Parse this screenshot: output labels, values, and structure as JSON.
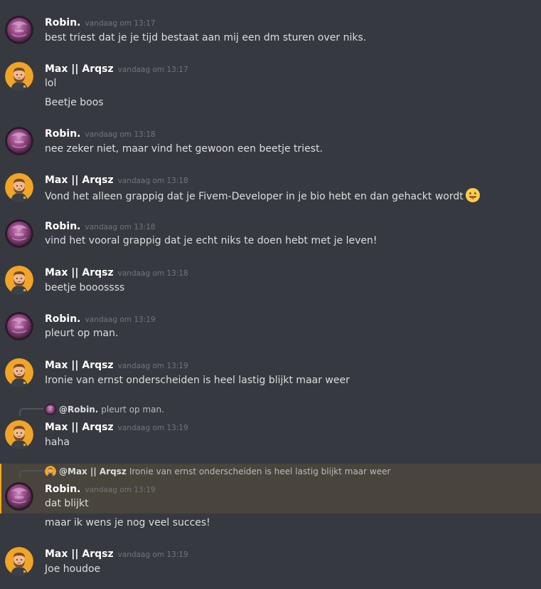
{
  "messages": [
    {
      "author": "Robin.",
      "time": "vandaag om 13:17",
      "lines": [
        "best triest dat je je tijd bestaat aan mij een dm sturen over niks."
      ]
    },
    {
      "author": "Max || Arqsz",
      "time": "vandaag om 13:17",
      "lines": [
        "lol",
        "Beetje boos"
      ]
    },
    {
      "author": "Robin.",
      "time": "vandaag om 13:18",
      "lines": [
        "nee zeker niet, maar vind het gewoon een beetje triest."
      ]
    },
    {
      "author": "Max || Arqsz",
      "time": "vandaag om 13:18",
      "lines": [
        "Vond het alleen grappig dat je Fivem-Developer in je bio hebt en dan gehackt wordt"
      ],
      "emoji": "tongue-out-emoji"
    },
    {
      "author": "Robin.",
      "time": "vandaag om 13:18",
      "lines": [
        "vind het vooral grappig dat je echt niks te doen hebt met je leven!"
      ]
    },
    {
      "author": "Max || Arqsz",
      "time": "vandaag om 13:18",
      "lines": [
        "beetje booossss"
      ]
    },
    {
      "author": "Robin.",
      "time": "vandaag om 13:19",
      "lines": [
        "pleurt op man."
      ]
    },
    {
      "author": "Max || Arqsz",
      "time": "vandaag om 13:19",
      "lines": [
        "Ironie van ernst onderscheiden is heel lastig blijkt maar weer"
      ]
    },
    {
      "author": "Max || Arqsz",
      "time": "vandaag om 13:19",
      "lines": [
        "haha"
      ],
      "reply": {
        "author": "@Robin.",
        "text": "pleurt op man."
      }
    },
    {
      "author": "Robin.",
      "time": "vandaag om 13:19",
      "lines": [
        "dat blijkt"
      ],
      "reply": {
        "author": "@Max || Arqsz",
        "text": "Ironie van ernst onderscheiden is heel lastig blijkt maar weer"
      }
    },
    {
      "author": "Robin.",
      "time": "",
      "lines": [
        "maar ik wens je nog veel succes!"
      ]
    },
    {
      "author": "Max || Arqsz",
      "time": "vandaag om 13:19",
      "lines": [
        "Joe houdoe"
      ]
    }
  ],
  "colors": {
    "background": "#36393f",
    "highlight": "#49443c",
    "mention_bar": "#faa81a",
    "author": "#ffffff",
    "timestamp": "#72767d",
    "text": "#dcddde"
  }
}
